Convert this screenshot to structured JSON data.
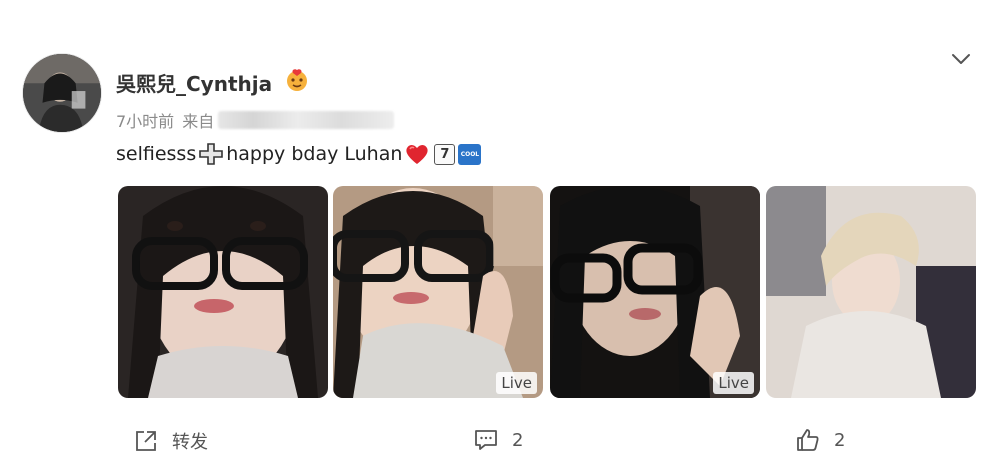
{
  "post": {
    "username": "吳熙兒_Cynthja",
    "time": "7小时前",
    "source_prefix": "来自",
    "content": {
      "text": "selfiesss",
      "text2": "happy bday Luhan",
      "keycap": "7",
      "cool_label": "COOL"
    },
    "photos": [
      {
        "live": ""
      },
      {
        "live": "Live"
      },
      {
        "live": "Live"
      },
      {
        "live": ""
      }
    ],
    "actions": {
      "repost_label": "转发",
      "comment_count": "2",
      "like_count": "2"
    },
    "colors": {
      "accent_blue": "#2a74c9",
      "heart_red": "#e0252f",
      "text_gray": "#8a8a8a"
    },
    "icons": [
      "fan-badge-icon",
      "chevron-down-icon",
      "cross-emoji-icon",
      "heart-emoji-icon",
      "share-icon",
      "comment-icon",
      "like-icon"
    ]
  }
}
